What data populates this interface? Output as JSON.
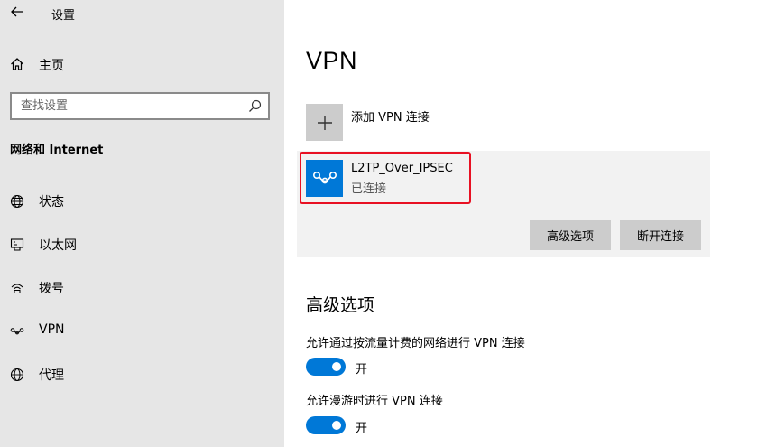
{
  "window": {
    "title": "设置"
  },
  "sidebar": {
    "home_label": "主页",
    "search_placeholder": "查找设置",
    "section_title": "网络和 Internet",
    "items": [
      {
        "label": "状态",
        "icon": "globe-status-icon"
      },
      {
        "label": "以太网",
        "icon": "ethernet-icon"
      },
      {
        "label": "拨号",
        "icon": "dialup-icon"
      },
      {
        "label": "VPN",
        "icon": "vpn-icon"
      },
      {
        "label": "代理",
        "icon": "globe-icon"
      }
    ]
  },
  "main": {
    "title": "VPN",
    "add_label": "添加 VPN 连接",
    "connection": {
      "name": "L2TP_Over_IPSEC",
      "status": "已连接"
    },
    "buttons": {
      "advanced": "高级选项",
      "disconnect": "断开连接"
    },
    "advanced_title": "高级选项",
    "options": [
      {
        "label": "允许通过按流量计费的网络进行 VPN 连接",
        "state": "开",
        "on": true
      },
      {
        "label": "允许漫游时进行 VPN 连接",
        "state": "开",
        "on": true
      }
    ]
  },
  "colors": {
    "accent": "#0078d7",
    "highlight": "#e81123",
    "sidebar_bg": "#e6e6e6"
  }
}
